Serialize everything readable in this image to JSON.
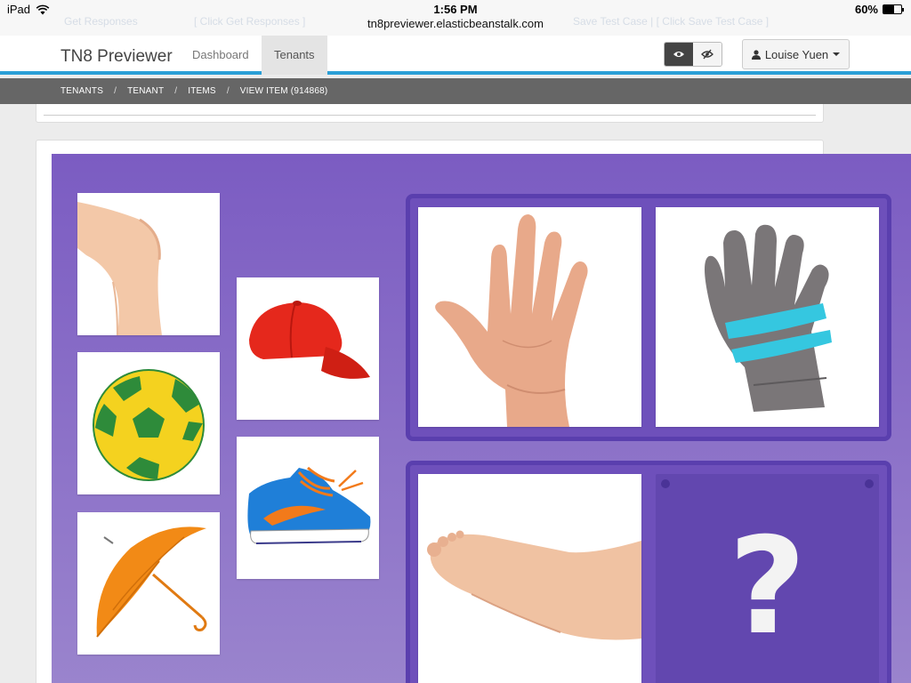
{
  "status_bar": {
    "device": "iPad",
    "time": "1:56 PM",
    "battery": "60%",
    "battery_level": 0.6,
    "url": "tn8previewer.elasticbeanstalk.com",
    "ghost_left": "Get Responses",
    "ghost_mid": "[ Click Get Responses ]",
    "ghost_right": "Save Test Case | [ Click Save Test Case ]"
  },
  "navbar": {
    "brand": "TN8 Previewer",
    "links": [
      {
        "label": "Dashboard",
        "active": false
      },
      {
        "label": "Tenants",
        "active": true
      }
    ],
    "view_toggle": [
      {
        "icon": "eye-icon",
        "active": true
      },
      {
        "icon": "eye-slash-icon",
        "active": false
      }
    ],
    "user": {
      "name": "Louise Yuen",
      "icon": "user-icon"
    }
  },
  "breadcrumb": [
    "TENANTS",
    "TENANT",
    "ITEMS",
    "VIEW ITEM (914868)"
  ],
  "colors": {
    "accent": "#2a9fd6",
    "stage_purple": "#7b5cc2",
    "zone_border": "#5a3fae",
    "breadcrumb_bg": "#666666"
  },
  "stage": {
    "choices": [
      {
        "name": "knee"
      },
      {
        "name": "soccer-ball"
      },
      {
        "name": "umbrella"
      },
      {
        "name": "red-cap"
      },
      {
        "name": "sneaker"
      }
    ],
    "pairs": [
      {
        "left": "hand",
        "right": "glove"
      },
      {
        "left": "foot",
        "right": "?"
      }
    ]
  }
}
